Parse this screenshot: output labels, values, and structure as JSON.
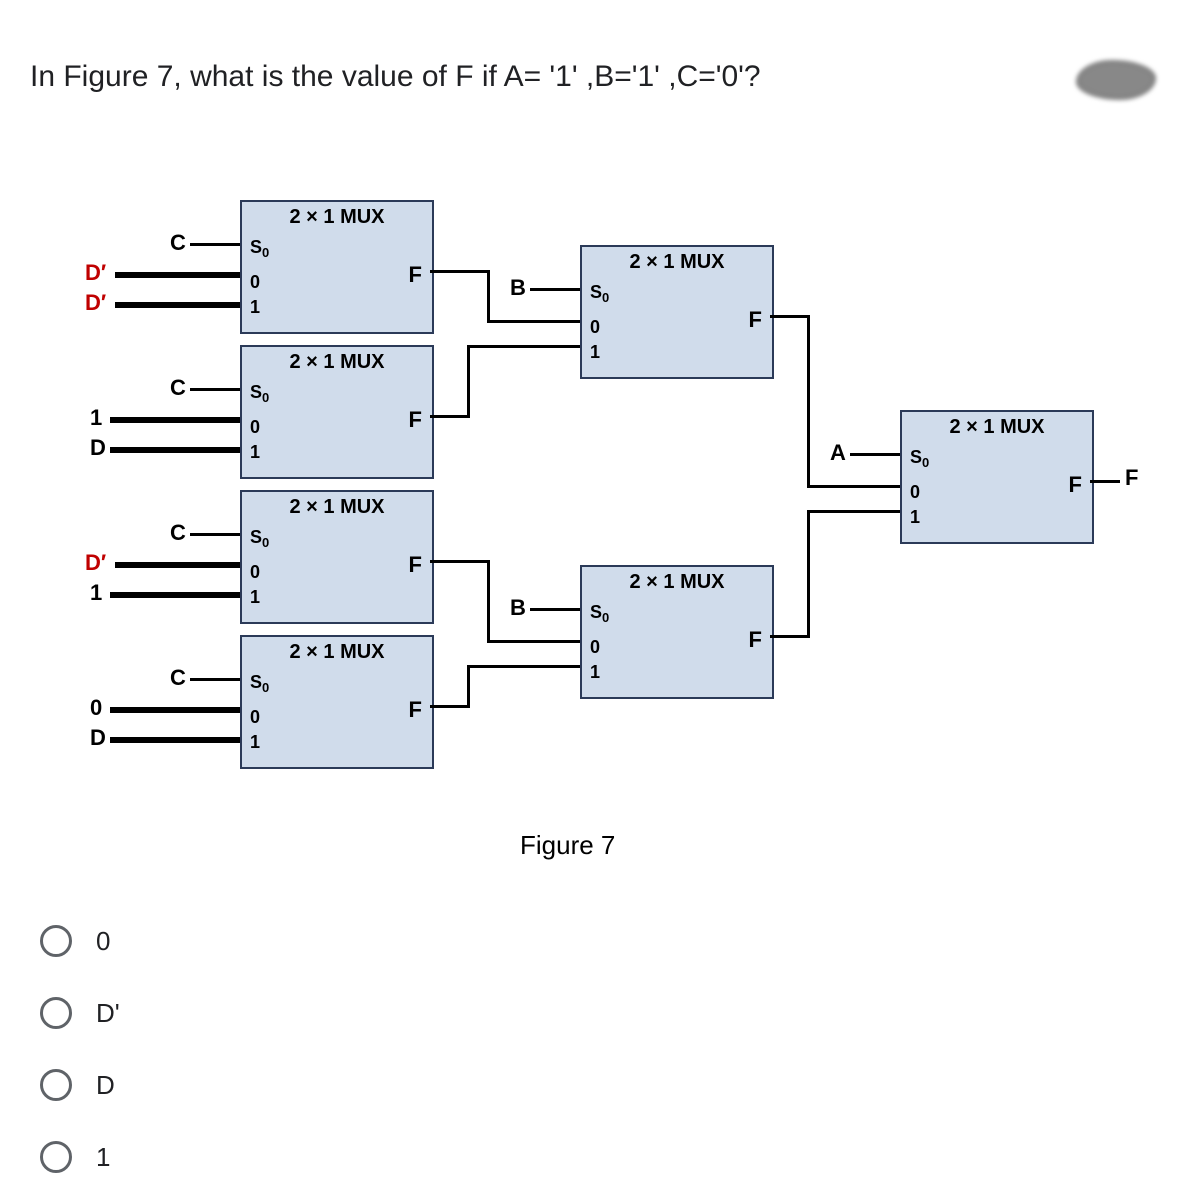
{
  "question": "In Figure 7, what is the value of F if A= '1' ,B='1' ,C='0'?",
  "caption": "Figure 7",
  "mux_label": "2 × 1 MUX",
  "S0": "S",
  "zero": "0",
  "one": "1",
  "F": "F",
  "inputs": {
    "c": "C",
    "dprime": "D′",
    "d": "D",
    "b": "B",
    "a": "A",
    "const0": "0",
    "const1": "1"
  },
  "answers": [
    "0",
    "D'",
    "D",
    "1"
  ]
}
